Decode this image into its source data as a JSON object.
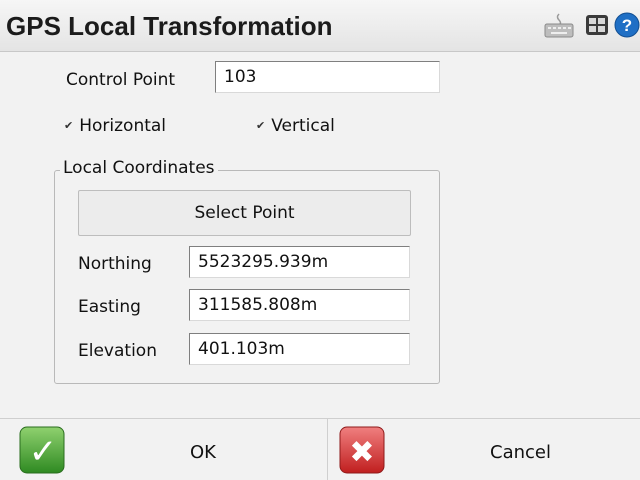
{
  "window": {
    "title": "GPS Local Transformation",
    "icons": [
      "keyboard-icon",
      "grid-icon",
      "help-icon"
    ],
    "colors": {
      "help": "#1f6fc5",
      "ok_green": "#3c9a2c",
      "cancel_red": "#d42f2f"
    }
  },
  "form": {
    "control_point_label": "Control Point",
    "control_point_value": "103",
    "horizontal_label": "Horizontal",
    "horizontal_checked": true,
    "vertical_label": "Vertical",
    "vertical_checked": true
  },
  "local": {
    "title": "Local Coordinates",
    "select_point_label": "Select Point",
    "northing_label": "Northing",
    "northing_value": "5523295.939m",
    "easting_label": "Easting",
    "easting_value": "311585.808m",
    "elevation_label": "Elevation",
    "elevation_value": "401.103m"
  },
  "actions": {
    "ok_label": "OK",
    "cancel_label": "Cancel"
  },
  "glyphs": {
    "check": "✓",
    "check_small": "✔",
    "cross": "✖",
    "help": "?"
  }
}
